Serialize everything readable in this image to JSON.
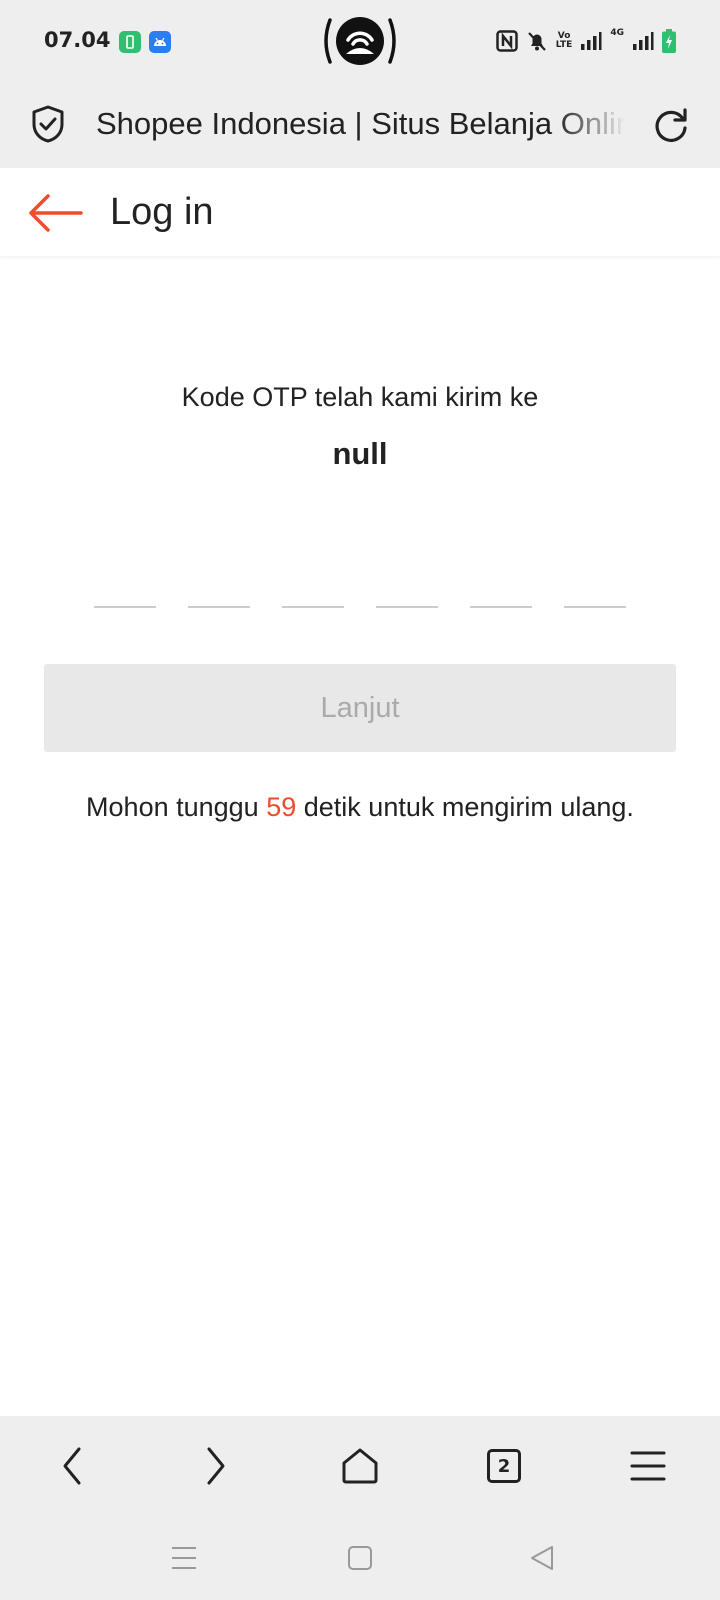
{
  "status_bar": {
    "time": "07.04",
    "network_label": "4G",
    "volte_label_top": "Vo",
    "volte_label_bottom": "LTE"
  },
  "browser": {
    "page_title": "Shopee Indonesia | Situs Belanja Online",
    "open_tabs": "2"
  },
  "header": {
    "title": "Log in"
  },
  "otp": {
    "sent_message": "Kode OTP telah kami kirim ke",
    "target": "null",
    "digit_count": 6
  },
  "continue_button": {
    "label": "Lanjut"
  },
  "resend": {
    "prefix": "Mohon tunggu",
    "seconds": "59",
    "suffix": "detik untuk mengirim ulang."
  },
  "colors": {
    "accent": "#ee4d2d",
    "disabled_button_bg": "#e8e8e8",
    "disabled_button_text": "#aaaaaa",
    "chrome_bg": "#eeeeee"
  }
}
